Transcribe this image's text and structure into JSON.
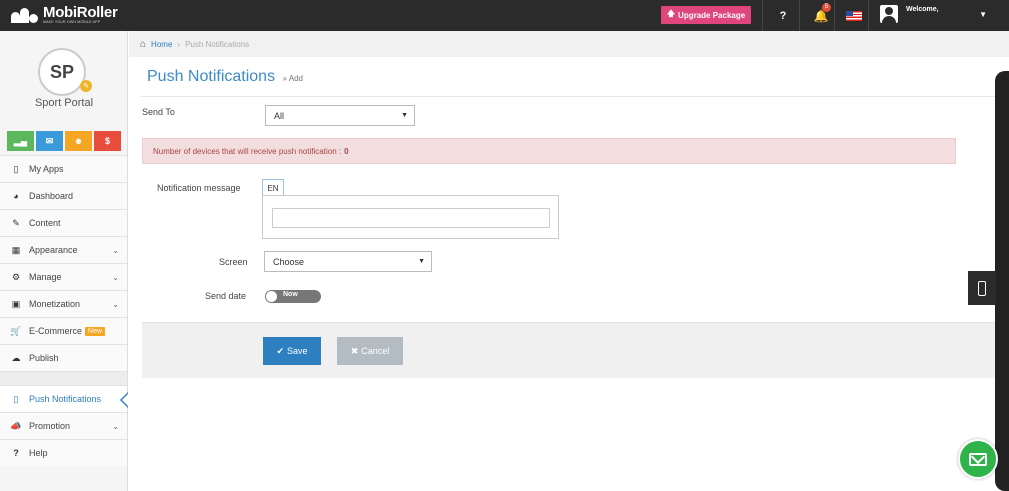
{
  "topbar": {
    "logo_name": "MobiRoller",
    "logo_tagline": "MAKE YOUR OWN MOBILE APP",
    "upgrade_label": "Upgrade Package",
    "help_label": "?",
    "notification_count": "5",
    "welcome": "Welcome,"
  },
  "profile": {
    "initials": "SP",
    "app_name": "Sport Portal",
    "quick_actions": [
      {
        "icon": "bar-chart-icon",
        "color": "#5cb85c"
      },
      {
        "icon": "envelope-icon",
        "color": "#3b9ad9"
      },
      {
        "icon": "users-icon",
        "color": "#f5a623"
      },
      {
        "icon": "dollar-icon",
        "glyph": "$",
        "color": "#e74c3c"
      }
    ]
  },
  "sidebar": {
    "items": [
      {
        "label": "My Apps",
        "icon": "mobile-icon"
      },
      {
        "label": "Dashboard",
        "icon": "tachometer-icon"
      },
      {
        "label": "Content",
        "icon": "edit-icon"
      },
      {
        "label": "Appearance",
        "icon": "th-large-icon"
      },
      {
        "label": "Manage",
        "icon": "cogs-icon"
      },
      {
        "label": "Monetization",
        "icon": "money-icon"
      },
      {
        "label": "E-Commerce",
        "icon": "cart-icon",
        "badge": "New"
      },
      {
        "label": "Publish",
        "icon": "cloud-upload-icon"
      }
    ],
    "items2": [
      {
        "label": "Push Notifications",
        "icon": "mobile-icon",
        "active": true
      },
      {
        "label": "Promotion",
        "icon": "bullhorn-icon"
      },
      {
        "label": "Help",
        "icon": "question-icon"
      }
    ]
  },
  "breadcrumb": {
    "home": "Home",
    "current": "Push Notifications"
  },
  "page": {
    "title": "Push Notifications",
    "subtitle": "» Add"
  },
  "form": {
    "send_to_label": "Send To",
    "send_to_value": "All",
    "alert_text": "Number of devices that will receive push notification :",
    "alert_count": "0",
    "message_label": "Notification message",
    "language_tab": "EN",
    "message_value": "",
    "screen_label": "Screen",
    "screen_value": "Choose",
    "send_date_label": "Send date",
    "send_date_toggle": "Now"
  },
  "actions": {
    "save": "Save",
    "cancel": "Cancel"
  },
  "colors": {
    "accent": "#2d7fc0",
    "upgrade": "#e0457b",
    "alert_bg": "#f2dede",
    "chat": "#2fb34a"
  }
}
